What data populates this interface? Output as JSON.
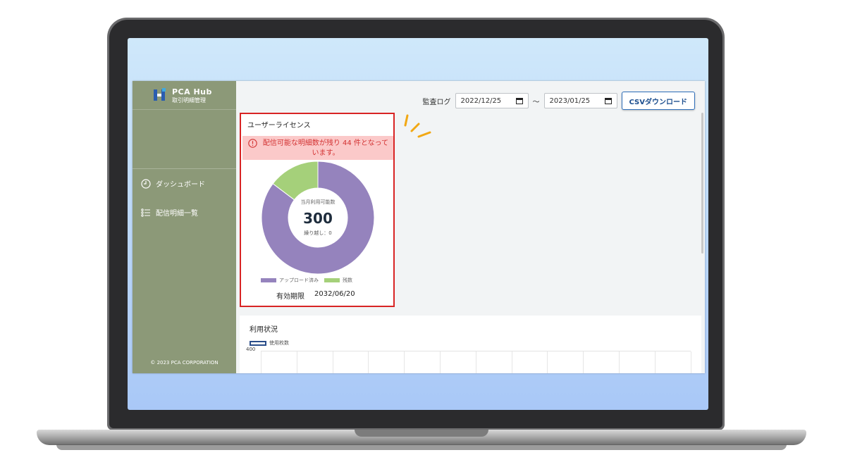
{
  "sidebar": {
    "logo_title": "PCA Hub",
    "logo_subtitle": "取引明細管理",
    "items": [
      {
        "label": "ダッシュボード",
        "icon": "clock-icon"
      },
      {
        "label": "配信明細一覧",
        "icon": "list-icon"
      }
    ],
    "footer": "© 2023 PCA CORPORATION"
  },
  "toolbar": {
    "audit_label": "監査ログ",
    "date_from": "2022/12/25",
    "separator": "～",
    "date_to": "2023/01/25",
    "csv_label": "CSVダウンロード"
  },
  "license": {
    "title": "ユーザーライセンス",
    "alert": "配信可能な明細数が残り 44 件となっています。",
    "center_label": "当月利用可能数",
    "center_value": "300",
    "carryover": "繰り越し：0",
    "legend": [
      {
        "label": "アップロード済み",
        "color": "#9583bd"
      },
      {
        "label": "残数",
        "color": "#a5d07a"
      }
    ],
    "uploaded_fraction": 0.853,
    "remaining_fraction": 0.147,
    "expiry_label": "有効期限",
    "expiry_date": "2032/06/20"
  },
  "usage": {
    "title": "利用状況",
    "legend_label": "使用枚数",
    "y_tick": "400"
  },
  "colors": {
    "sidebar": "#8c9978",
    "accent": "#2f6fba",
    "alert_bg": "#fbc9c9",
    "alert_text": "#d33333",
    "highlight_border": "#d82424",
    "spark": "#f2a814"
  }
}
